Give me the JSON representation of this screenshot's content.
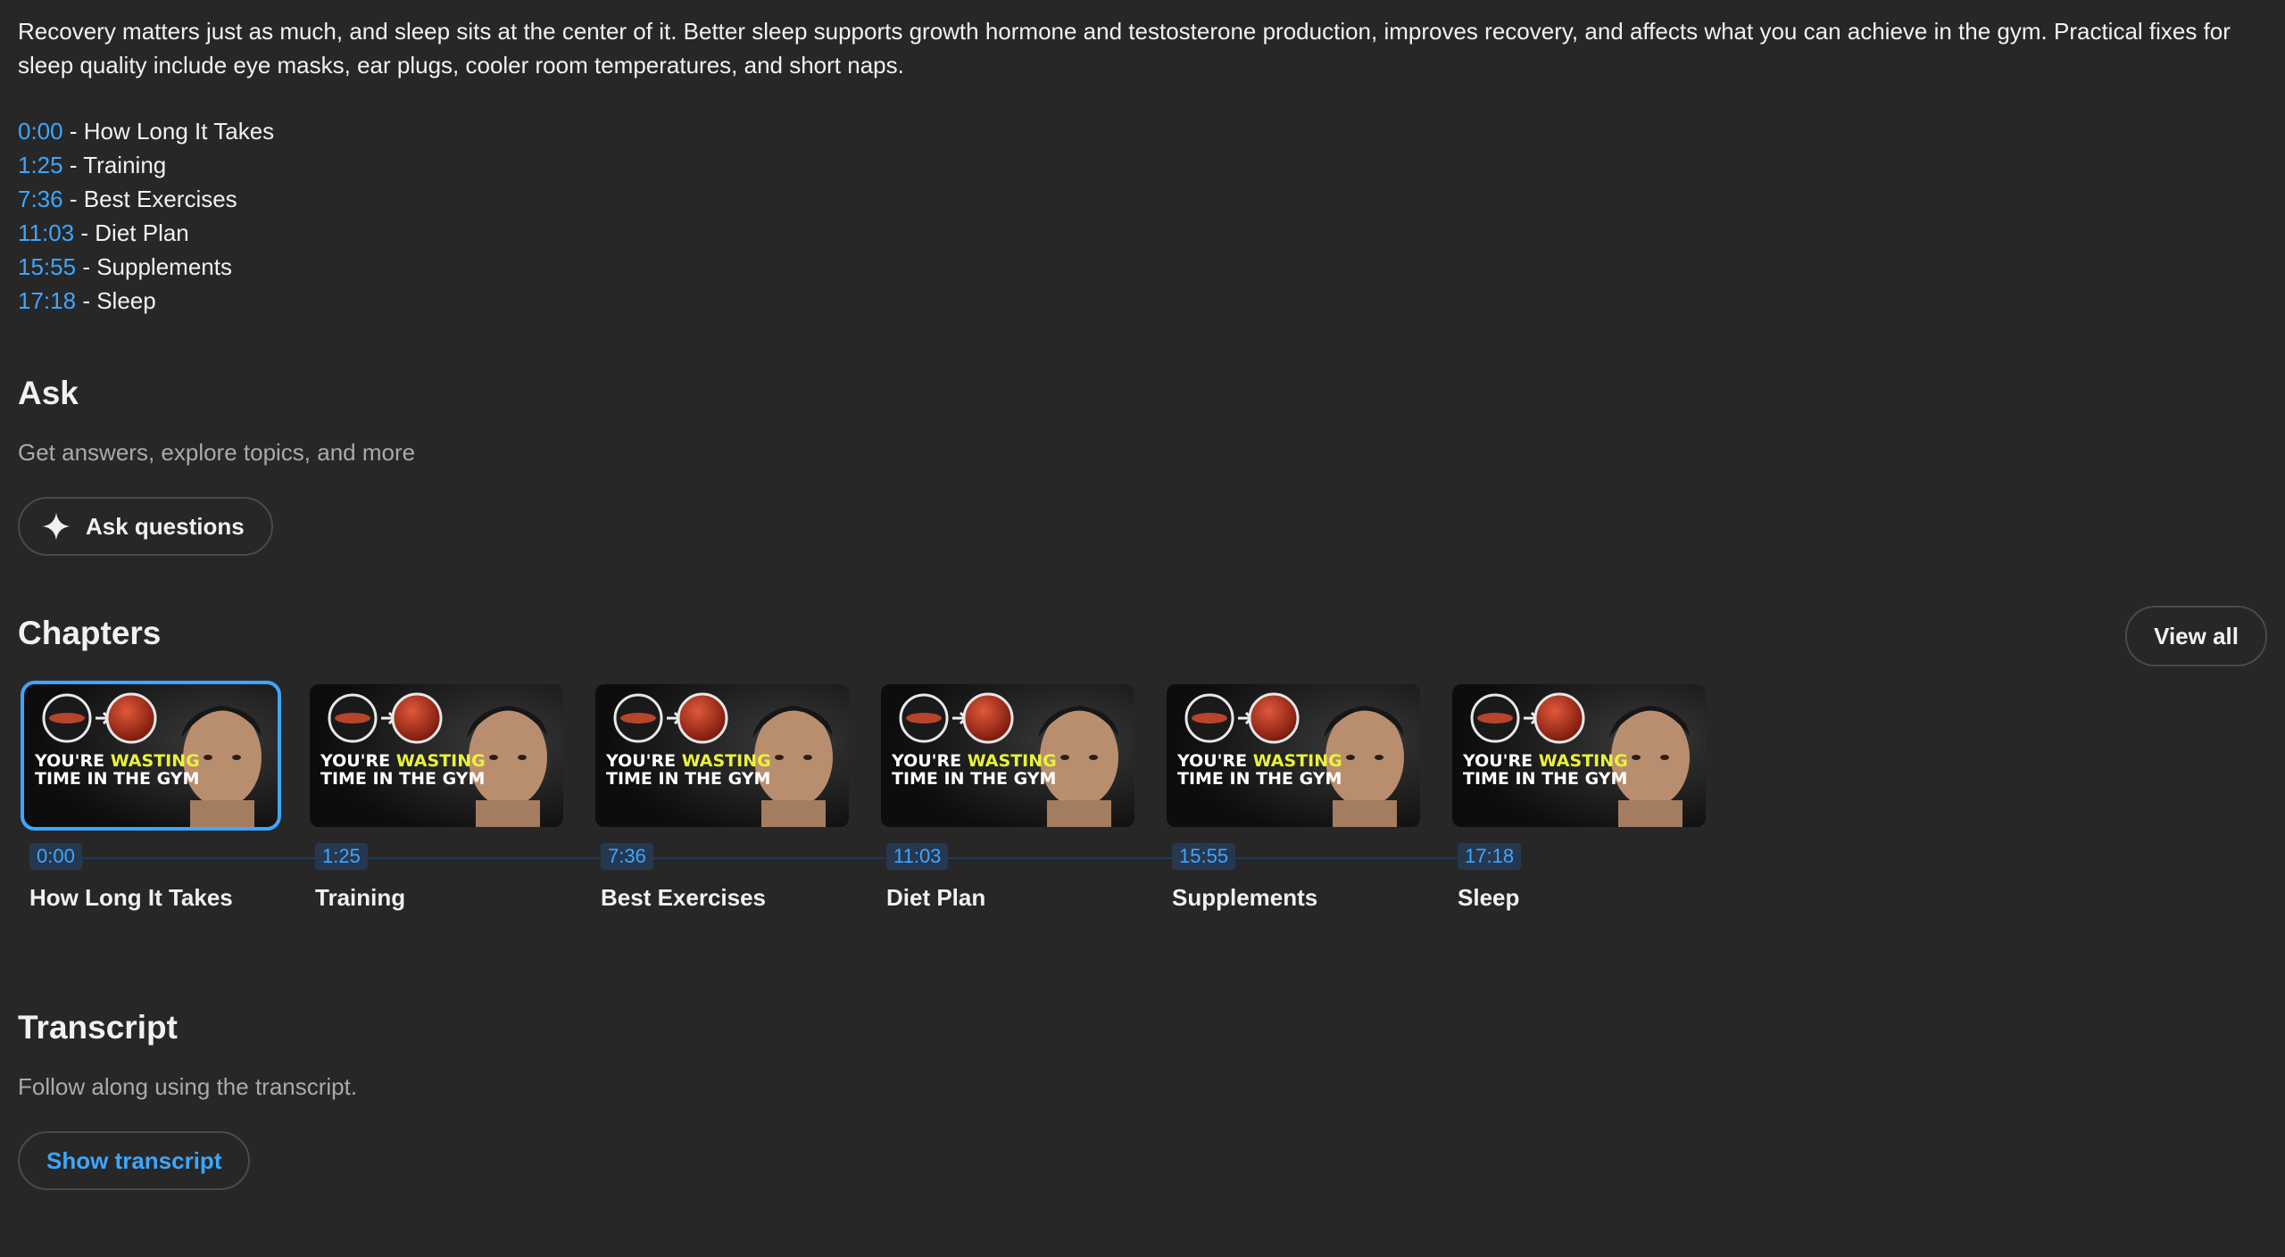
{
  "description": "Recovery matters just as much, and sleep sits at the center of it. Better sleep supports growth hormone and testosterone production, improves recovery, and affects what you can achieve in the gym. Practical fixes for sleep quality include eye masks, ear plugs, cooler room temperatures, and short naps.",
  "timestamps": [
    {
      "time": "0:00",
      "label": "How Long It Takes"
    },
    {
      "time": "1:25",
      "label": "Training"
    },
    {
      "time": "7:36",
      "label": "Best Exercises"
    },
    {
      "time": "11:03",
      "label": "Diet Plan"
    },
    {
      "time": "15:55",
      "label": "Supplements"
    },
    {
      "time": "17:18",
      "label": "Sleep"
    }
  ],
  "separator": "-",
  "ask": {
    "title": "Ask",
    "subtitle": "Get answers, explore topics, and more",
    "button_label": "Ask questions",
    "button_icon": "sparkle-icon"
  },
  "chapters": {
    "title": "Chapters",
    "view_all_label": "View all",
    "thumbnail_text_line1_a": "YOU'RE",
    "thumbnail_text_line1_b": "WASTING",
    "thumbnail_text_line2": "TIME IN THE GYM",
    "items": [
      {
        "time": "0:00",
        "label": "How Long It Takes",
        "selected": true
      },
      {
        "time": "1:25",
        "label": "Training",
        "selected": false
      },
      {
        "time": "7:36",
        "label": "Best Exercises",
        "selected": false
      },
      {
        "time": "11:03",
        "label": "Diet Plan",
        "selected": false
      },
      {
        "time": "15:55",
        "label": "Supplements",
        "selected": false
      },
      {
        "time": "17:18",
        "label": "Sleep",
        "selected": false
      }
    ]
  },
  "transcript": {
    "title": "Transcript",
    "subtitle": "Follow along using the transcript.",
    "button_label": "Show transcript"
  },
  "colors": {
    "background": "#272727",
    "link": "#3ea6ff",
    "thumbnail_highlight": "#e9f23a"
  }
}
